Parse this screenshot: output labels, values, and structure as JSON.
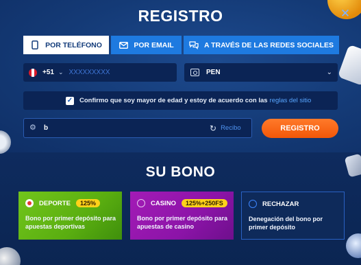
{
  "dialog": {
    "title": "REGISTRO",
    "close_icon": "close-icon"
  },
  "tabs": [
    {
      "label": "POR TELÉFONO",
      "icon": "phone-icon",
      "active": true
    },
    {
      "label": "POR EMAIL",
      "icon": "envelope-icon",
      "active": false
    },
    {
      "label": "A TRAVÉS DE LAS REDES SOCIALES",
      "icon": "chat-icon",
      "active": false
    }
  ],
  "phone": {
    "country_flag": "peru-flag-icon",
    "prefix": "+51",
    "placeholder": "XXXXXXXXX",
    "value": ""
  },
  "currency": {
    "icon": "cash-icon",
    "value": "PEN"
  },
  "confirm": {
    "checked": true,
    "text": "Confirmo que soy mayor de edad y estoy de acuerdo con las",
    "link": "reglas del sitio"
  },
  "promo": {
    "icon": "gear-icon",
    "value": "b",
    "reload_icon": "reload-icon",
    "link": "Recibo"
  },
  "register_button": "REGISTRO",
  "bonus": {
    "title": "SU BONO",
    "cards": [
      {
        "name": "DEPORTE",
        "badge": "125%",
        "description": "Bono por primer depósito para apuestas deportivas",
        "selected": true,
        "color": "#62b516"
      },
      {
        "name": "CASINO",
        "badge": "125%+250FS",
        "description": "Bono por primer depósito para apuestas de casino",
        "selected": false,
        "color": "#9416aa"
      },
      {
        "name": "RECHAZAR",
        "badge": "",
        "description": "Denegación del bono por primer depósito",
        "selected": false,
        "color": "#0e2a5a"
      }
    ]
  },
  "colors": {
    "accent": "#1e7ae0",
    "primary_button": "#f25708",
    "link": "#58a6ff",
    "background": "#143a76"
  }
}
